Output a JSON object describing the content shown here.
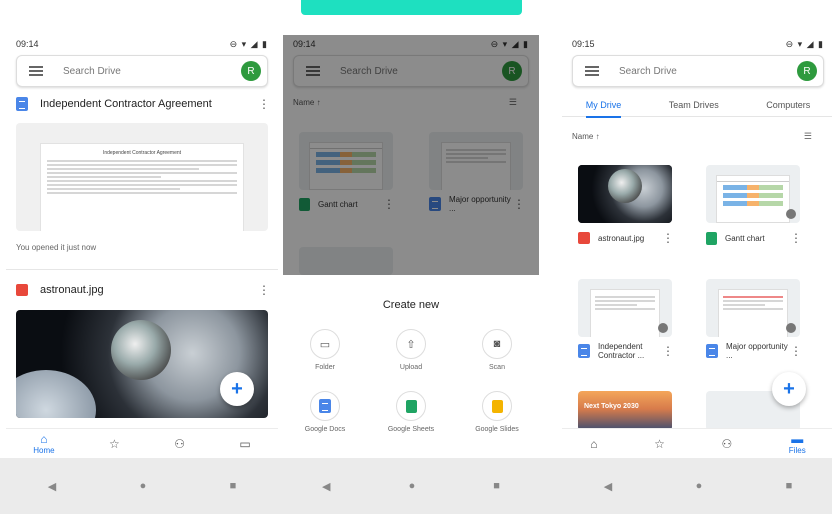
{
  "colors": {
    "accent": "#1a73e8",
    "teal": "#1ee0c0",
    "avatar": "#2e9a3e"
  },
  "phone1": {
    "time": "09:14",
    "search_placeholder": "Search Drive",
    "avatar_letter": "R",
    "file1_name": "Independent Contractor Agreement",
    "doc_preview_title": "Independent Contractor Agreement",
    "opened_note": "You opened it just now",
    "file2_name": "astronaut.jpg",
    "nav": {
      "home_label": "Home"
    },
    "fab_glyph": "+"
  },
  "phone2": {
    "time": "09:14",
    "search_placeholder": "Search Drive",
    "avatar_letter": "R",
    "sort_label": "Name ↑",
    "tile1_label": "Gantt chart",
    "tile2_label": "Major opportunity ...",
    "sheet_title": "Create new",
    "options": {
      "folder": "Folder",
      "upload": "Upload",
      "scan": "Scan",
      "docs": "Google Docs",
      "sheets": "Google Sheets",
      "slides": "Google Slides"
    }
  },
  "phone3": {
    "time": "09:15",
    "search_placeholder": "Search Drive",
    "avatar_letter": "R",
    "tabs": {
      "my_drive": "My Drive",
      "team_drives": "Team Drives",
      "computers": "Computers"
    },
    "sort_label": "Name ↑",
    "files": {
      "astronaut": "astronaut.jpg",
      "gantt": "Gantt chart",
      "contractor": "Independent Contractor ...",
      "major": "Major opportunity ..."
    },
    "tokyo_text": "Next Tokyo 2030",
    "nav": {
      "files_label": "Files"
    },
    "fab_glyph": "+"
  }
}
